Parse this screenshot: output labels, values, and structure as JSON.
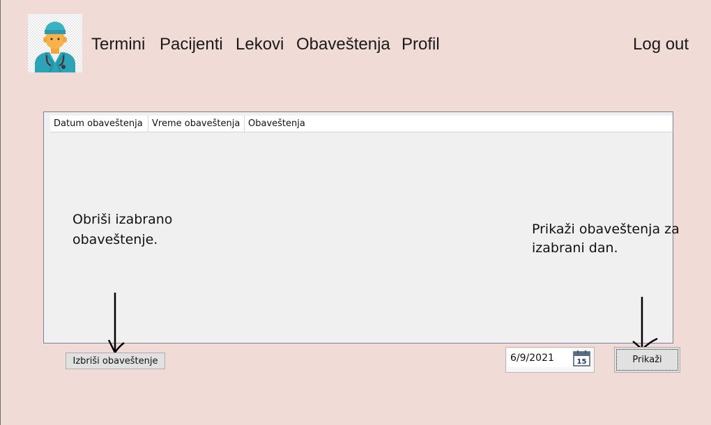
{
  "nav": {
    "items": [
      {
        "label": "Termini"
      },
      {
        "label": "Pacijenti"
      },
      {
        "label": "Lekovi"
      },
      {
        "label": "Obaveštenja"
      },
      {
        "label": "Profil"
      }
    ],
    "logout_label": "Log out"
  },
  "avatar": {
    "icon": "doctor-avatar-icon"
  },
  "table": {
    "columns": [
      "Datum obaveštenja",
      "Vreme obaveštenja",
      "Obaveštenja"
    ],
    "rows": []
  },
  "annotations": {
    "left_line1": "Obriši izabrano",
    "left_line2": "obaveštenje.",
    "right_line1": "Prikaži obaveštenja za",
    "right_line2": "izabrani dan."
  },
  "buttons": {
    "delete_label": "Izbriši obaveštenje",
    "show_label": "Prikaži"
  },
  "date_picker": {
    "value": "6/9/2021",
    "calendar_day": "15"
  },
  "colors": {
    "background": "#f1dbd6",
    "panel": "#f0f0f0",
    "panel_border": "#7a7f9a"
  }
}
